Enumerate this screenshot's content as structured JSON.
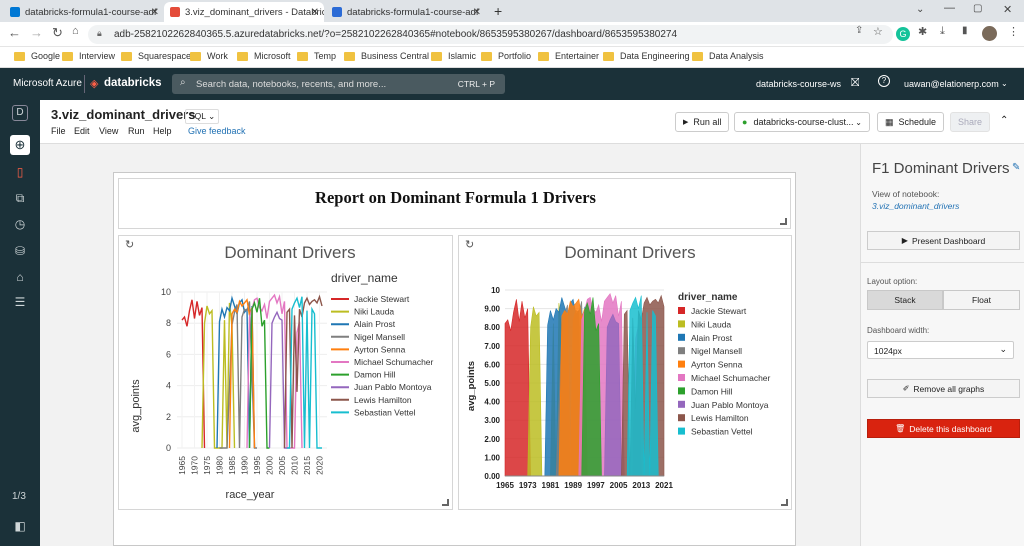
{
  "browser": {
    "tabs": [
      {
        "title": "databricks-formula1-course-adf",
        "active": false
      },
      {
        "title": "3.viz_dominant_drivers - Databric",
        "active": true
      },
      {
        "title": "databricks-formula1-course-adf",
        "active": false
      }
    ],
    "url": "adb-2582102262840365.5.azuredatabricks.net/?o=2582102262840365#notebook/8653595380267/dashboard/8653595380274",
    "bookmarks": [
      "Google",
      "Interview",
      "Squarespace",
      "Work",
      "Microsoft",
      "Temp",
      "Business Central",
      "Islamic",
      "Portfolio",
      "Entertainer",
      "Data Engineering",
      "Data Analysis"
    ]
  },
  "topnav": {
    "brand": "Microsoft Azure",
    "product": "databricks",
    "search_placeholder": "Search data, notebooks, recents, and more...",
    "search_shortcut": "CTRL + P",
    "workspace": "databricks-course-ws",
    "user": "uawan@elationerp.com"
  },
  "notebook": {
    "title": "3.viz_dominant_drivers",
    "language": "SQL",
    "menu": [
      "File",
      "Edit",
      "View",
      "Run",
      "Help"
    ],
    "feedback": "Give feedback",
    "run_all": "Run all",
    "cluster": "databricks-course-clust...",
    "schedule": "Schedule",
    "share": "Share"
  },
  "leftrail": {
    "page": "1/3"
  },
  "dashboard": {
    "report_title": "Report on Dominant Formula 1 Drivers",
    "chart1": {
      "title": "Dominant Drivers",
      "legend_title": "driver_name",
      "xlabel": "race_year",
      "ylabel": "avg_points"
    },
    "chart2": {
      "title": "Dominant Drivers",
      "legend_title": "driver_name",
      "ylabel": "avg_points"
    }
  },
  "rightpanel": {
    "title": "F1 Dominant Drivers",
    "view_label": "View of notebook:",
    "notebook_link": "3.viz_dominant_drivers",
    "present": "Present Dashboard",
    "layout_label": "Layout option:",
    "stack": "Stack",
    "float": "Float",
    "width_label": "Dashboard width:",
    "width_value": "1024px",
    "remove": "Remove all graphs",
    "delete": "Delete this dashboard"
  },
  "colors": {
    "accent": "#1b3139",
    "danger": "#d9230f",
    "link": "#2272b4"
  },
  "chart_data": [
    {
      "type": "line",
      "title": "Dominant Drivers",
      "xlabel": "race_year",
      "ylabel": "avg_points",
      "legend_title": "driver_name",
      "xlim": [
        1963,
        2023
      ],
      "ylim": [
        0,
        10
      ],
      "x_ticks": [
        "1965",
        "1970",
        "1975",
        "1980",
        "1985",
        "1990",
        "1995",
        "2000",
        "2005",
        "2010",
        "2015",
        "2020"
      ],
      "y_ticks": [
        "0",
        "2",
        "4",
        "6",
        "8",
        "10"
      ],
      "series": [
        {
          "name": "Jackie Stewart",
          "color": "#d62728",
          "x": [
            1965,
            1966,
            1967,
            1968,
            1969,
            1970,
            1971,
            1972,
            1973,
            1974
          ],
          "y": [
            8.2,
            8.4,
            7.8,
            8.8,
            9.5,
            8.3,
            9.4,
            8.5,
            9.0,
            0
          ]
        },
        {
          "name": "Niki Lauda",
          "color": "#bcbd22",
          "x": [
            1973,
            1974,
            1975,
            1976,
            1977,
            1978,
            1979,
            1980,
            1981,
            1982,
            1983,
            1984,
            1985,
            1986
          ],
          "y": [
            0,
            8.0,
            9.1,
            8.6,
            8.8,
            0,
            0,
            0,
            0,
            8.2,
            0,
            9.3,
            7.8,
            0
          ]
        },
        {
          "name": "Alain Prost",
          "color": "#1f77b4",
          "x": [
            1979,
            1980,
            1981,
            1982,
            1983,
            1984,
            1985,
            1986,
            1987,
            1988,
            1989,
            1990,
            1991,
            1992,
            1993,
            1994
          ],
          "y": [
            0,
            8.1,
            8.9,
            8.4,
            9.0,
            8.8,
            9.6,
            9.1,
            8.6,
            9.3,
            9.5,
            8.7,
            8.9,
            0,
            9.1,
            0
          ]
        },
        {
          "name": "Nigel Mansell",
          "color": "#7f7f7f",
          "x": [
            1980,
            1981,
            1983,
            1985,
            1986,
            1987,
            1988,
            1989,
            1990,
            1991,
            1992,
            1994,
            1995
          ],
          "y": [
            0,
            0,
            0,
            7.9,
            8.7,
            9.2,
            0,
            8.4,
            8.9,
            8.8,
            9.4,
            0,
            0
          ]
        },
        {
          "name": "Ayrton Senna",
          "color": "#ff7f0e",
          "x": [
            1984,
            1985,
            1986,
            1987,
            1988,
            1989,
            1990,
            1991,
            1992,
            1993,
            1994
          ],
          "y": [
            0,
            8.6,
            8.9,
            8.7,
            9.4,
            9.1,
            9.3,
            9.5,
            8.5,
            9.0,
            0
          ]
        },
        {
          "name": "Michael Schumacher",
          "color": "#e377c2",
          "x": [
            1991,
            1992,
            1993,
            1994,
            1995,
            1996,
            1997,
            1998,
            1999,
            2000,
            2001,
            2002,
            2003,
            2004,
            2005,
            2006,
            2007,
            2010,
            2011,
            2012,
            2013
          ],
          "y": [
            0,
            8.4,
            8.9,
            9.5,
            9.6,
            9.0,
            8.8,
            9.2,
            8.3,
            9.4,
            9.6,
            9.8,
            9.3,
            9.7,
            8.6,
            9.4,
            0,
            0,
            7.4,
            8.1,
            0
          ]
        },
        {
          "name": "Damon Hill",
          "color": "#2ca02c",
          "x": [
            1992,
            1993,
            1994,
            1995,
            1996,
            1997,
            1998,
            1999,
            2000
          ],
          "y": [
            0,
            8.9,
            9.3,
            8.7,
            9.6,
            7.8,
            8.2,
            0,
            0
          ]
        },
        {
          "name": "Juan Pablo Montoya",
          "color": "#9467bd",
          "x": [
            2000,
            2001,
            2002,
            2003,
            2004,
            2005,
            2006,
            2007
          ],
          "y": [
            0,
            8.0,
            8.4,
            8.7,
            8.3,
            8.2,
            0,
            0
          ]
        },
        {
          "name": "Lewis Hamilton",
          "color": "#8c564b",
          "x": [
            2006,
            2007,
            2008,
            2009,
            2010,
            2011,
            2012,
            2013,
            2014,
            2015,
            2016,
            2017,
            2018,
            2019,
            2020,
            2021
          ],
          "y": [
            0,
            8.7,
            8.9,
            0,
            8.5,
            3.6,
            8.9,
            8.4,
            9.3,
            9.6,
            9.2,
            9.4,
            9.5,
            9.3,
            9.7,
            9.1
          ]
        },
        {
          "name": "Sebastian Vettel",
          "color": "#17becf",
          "x": [
            2007,
            2008,
            2009,
            2010,
            2011,
            2012,
            2013,
            2014,
            2015,
            2016,
            2017,
            2018,
            2019,
            2020,
            2021
          ],
          "y": [
            0,
            0,
            8.9,
            9.3,
            9.6,
            9.0,
            9.7,
            0,
            8.8,
            0,
            8.9,
            8.6,
            0,
            0,
            0
          ]
        }
      ]
    },
    {
      "type": "area",
      "title": "Dominant Drivers",
      "ylabel": "avg_points",
      "legend_title": "driver_name",
      "xlim": [
        1965,
        2021
      ],
      "ylim": [
        0,
        10
      ],
      "x_ticks": [
        "1965",
        "1973",
        "1981",
        "1989",
        "1997",
        "2005",
        "2013",
        "2021"
      ],
      "y_ticks": [
        "0.00",
        "1.00",
        "2.00",
        "3.00",
        "4.00",
        "5.00",
        "6.00",
        "7.00",
        "8.00",
        "9.00",
        "10"
      ],
      "series_ref": "same as chart_data[0].series"
    }
  ]
}
